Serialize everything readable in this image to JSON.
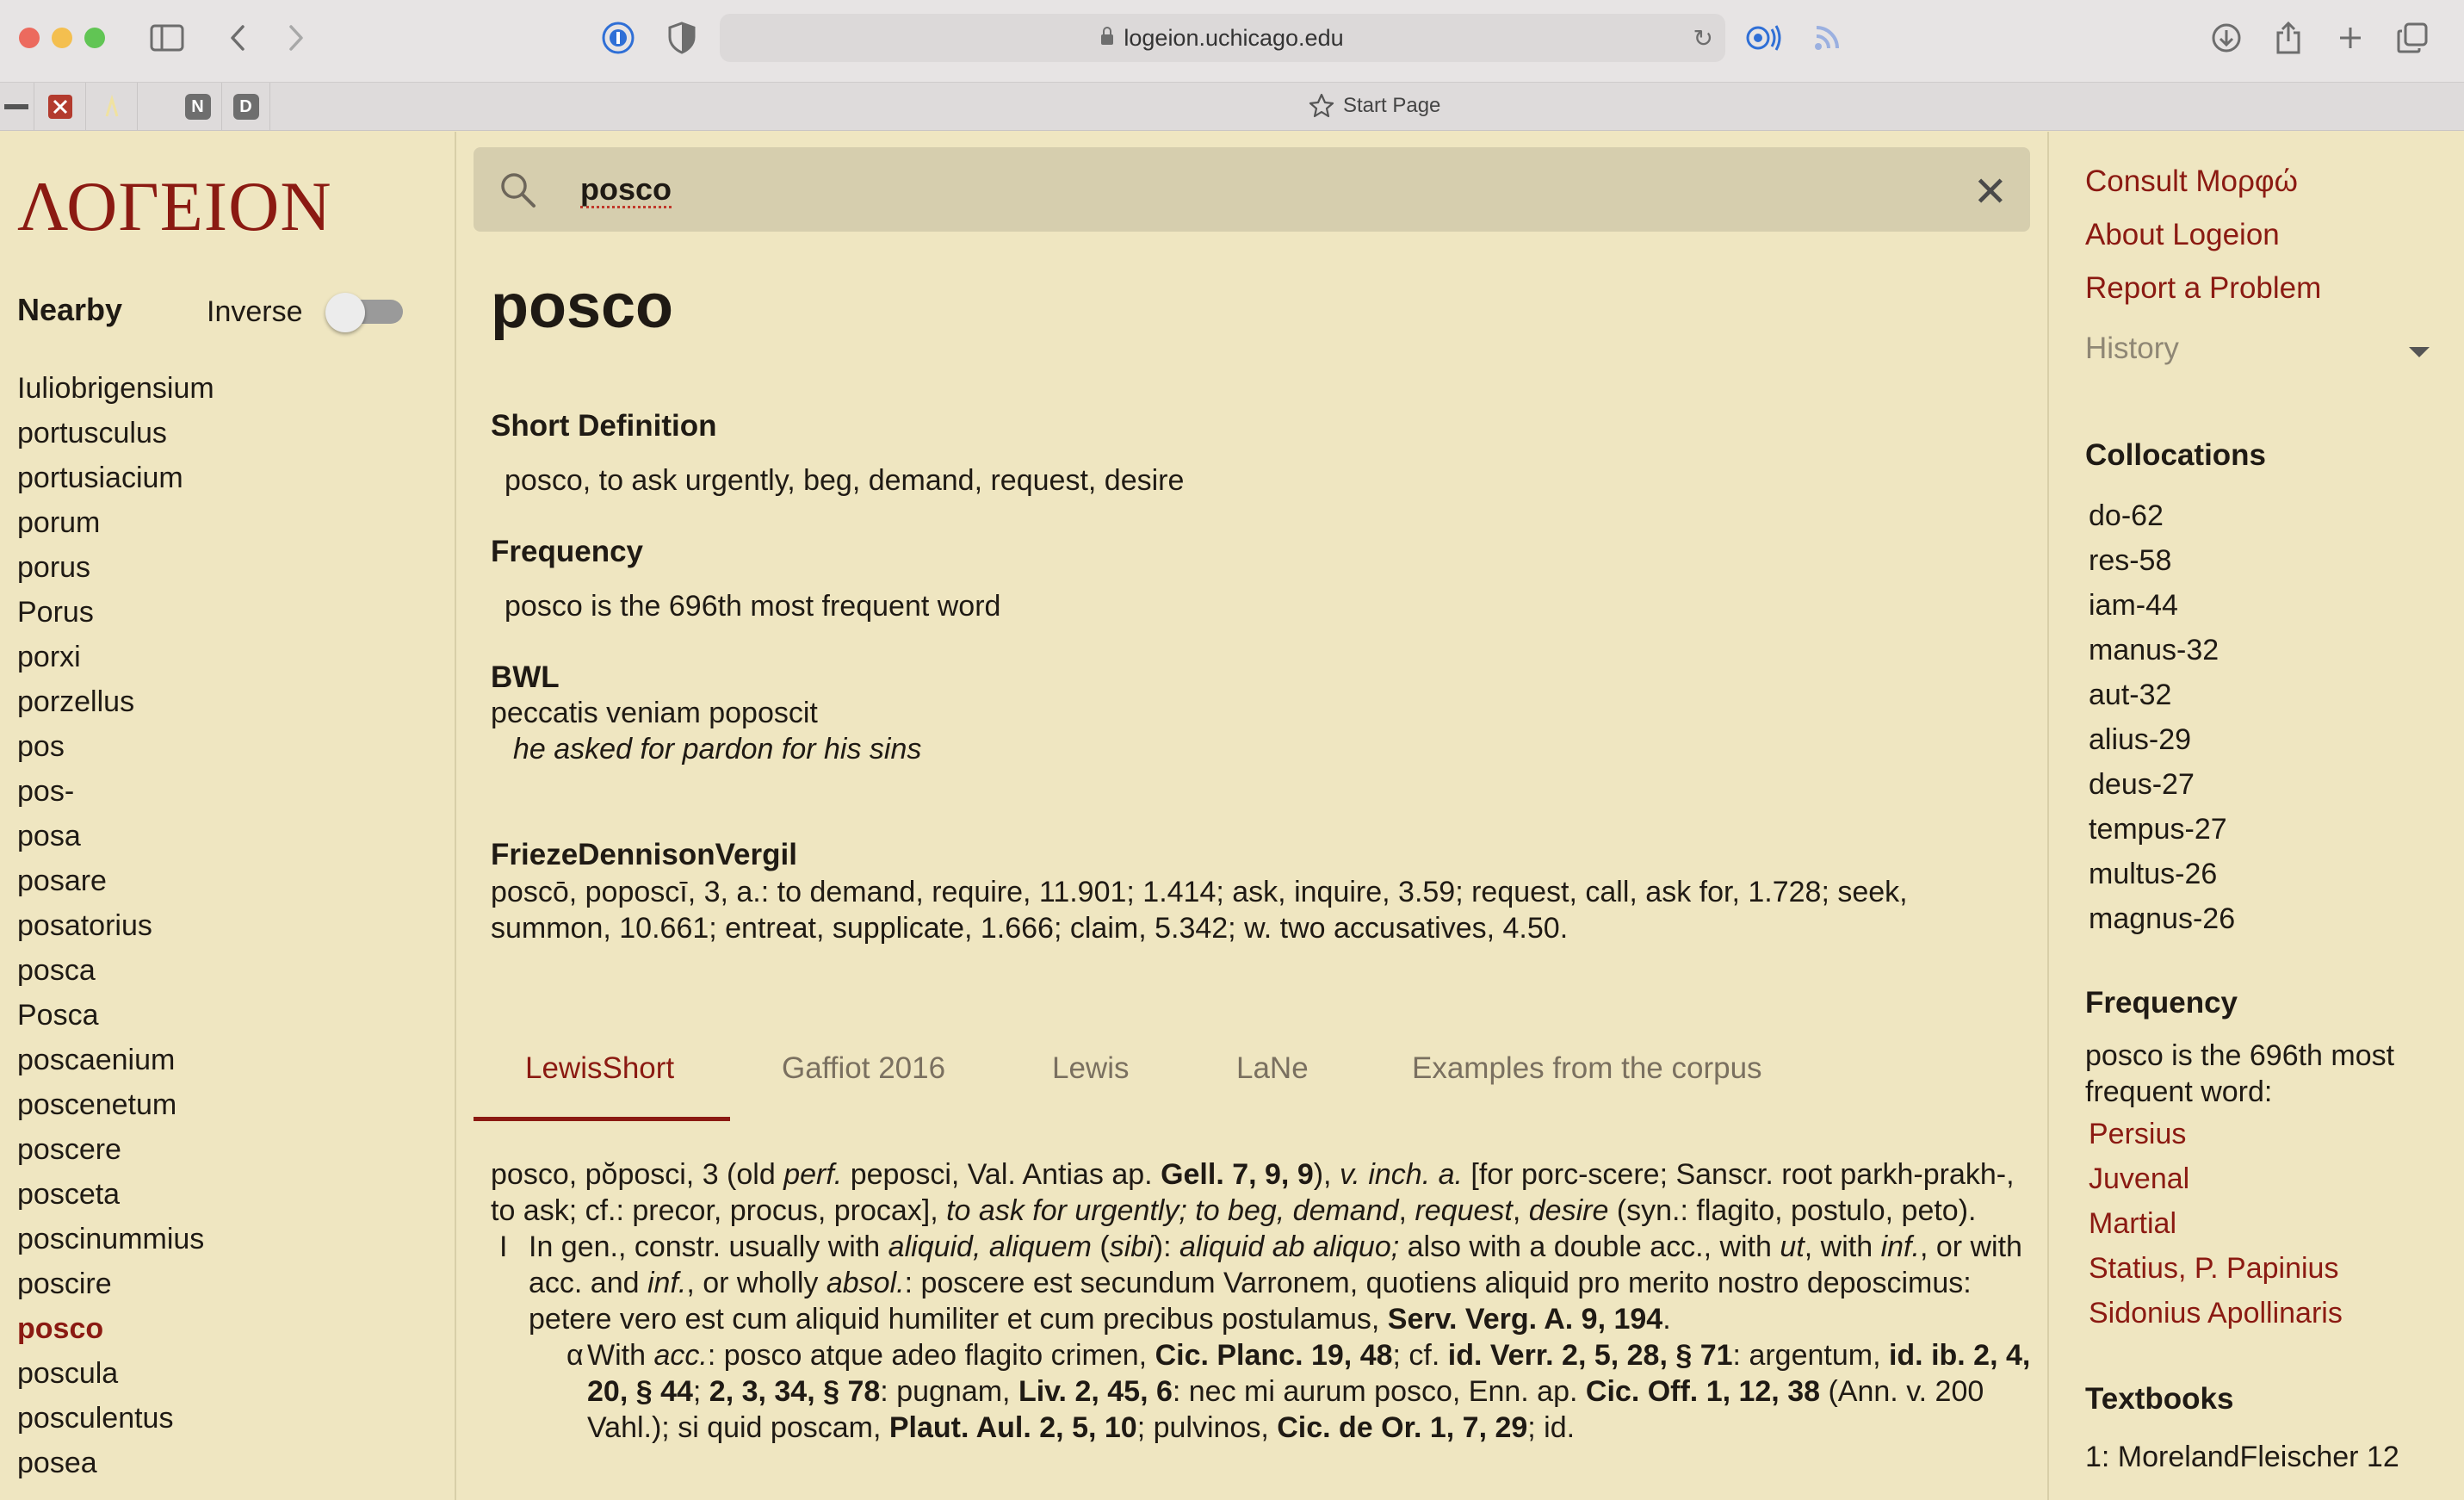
{
  "browser": {
    "url": "logeion.uchicago.edu",
    "start_page_label": "Start Page",
    "pinned_tabs": [
      "N",
      "D"
    ]
  },
  "sidebar": {
    "logo": "ΛΟΓΕΙΟΝ",
    "nearby_label": "Nearby",
    "inverse_label": "Inverse",
    "inverse_on": false,
    "words": [
      "Iuliobrigensium",
      "portusculus",
      "portusiacium",
      "porum",
      "porus",
      "Porus",
      "porxi",
      "porzellus",
      "pos",
      "pos-",
      "posa",
      "posare",
      "posatorius",
      "posca",
      "Posca",
      "poscaenium",
      "poscenetum",
      "poscere",
      "posceta",
      "poscinummius",
      "poscire",
      "posco",
      "poscula",
      "posculentus",
      "posea"
    ],
    "active_word": "posco"
  },
  "search": {
    "query": "posco"
  },
  "main": {
    "headword": "posco",
    "short_def_heading": "Short Definition",
    "short_def": "posco, to ask urgently, beg, demand, request, desire",
    "freq_heading": "Frequency",
    "freq_text": "posco is the 696th most frequent word",
    "bwl_heading": "BWL",
    "bwl_latin": "peccatis veniam poposcit",
    "bwl_translation": "he asked for pardon for his sins",
    "fd_heading": "FriezeDennisonVergil",
    "fd_text": "poscō, poposcī, 3, a.: to demand, require, 11.901; 1.414; ask, inquire, 3.59; request, call, ask for, 1.728; seek, summon, 10.661; entreat, supplicate, 1.666; claim, 5.342; w. two accusatives, 4.50.",
    "tabs": [
      "LewisShort",
      "Gaffiot 2016",
      "Lewis",
      "LaNe",
      "Examples from the corpus"
    ],
    "active_tab": "LewisShort",
    "entry": {
      "p1a": "posco, pŏposci, 3 (old ",
      "p1b": "perf.",
      "p1c": " peposci, Val. Antias ap. ",
      "p1d": "Gell. 7, 9, 9",
      "p1e": "), ",
      "p1f": "v. inch. a.",
      "p1g": " [for porc-scere; Sanscr. root parkh-prakh-, to ask; cf.: precor, procus, procax], ",
      "p1h": "to ask for urgently; to beg, demand",
      "p1i": ", ",
      "p1j": "request",
      "p1k": ", ",
      "p1l": "desire",
      "p1m": " (syn.: flagito, postulo, peto).",
      "s1_num": "I",
      "s1a": "In gen., constr. usually with ",
      "s1b": "aliquid, aliquem",
      "s1c": " (",
      "s1d": "sibi",
      "s1e": "): ",
      "s1f": "aliquid ab aliquo;",
      "s1g": " also with a double acc., with ",
      "s1h": "ut",
      "s1i": ", with ",
      "s1j": "inf.",
      "s1k": ", or with acc. and ",
      "s1l": "inf.",
      "s1m": ", or wholly ",
      "s1n": "absol.",
      "s1o": ": poscere est secundum Varronem, quotiens aliquid pro merito nostro deposcimus: petere vero est cum aliquid humiliter et cum precibus postulamus, ",
      "s1p": "Serv. Verg. A. 9, 194",
      "s1q": ".",
      "s2_num": "α",
      "s2a": "With ",
      "s2b": "acc.",
      "s2c": ": posco atque adeo flagito crimen, ",
      "s2d": "Cic. Planc. 19, 48",
      "s2e": "; cf. ",
      "s2f": "id. Verr. 2, 5, 28, § 71",
      "s2g": ": argentum, ",
      "s2h": "id. ib. 2, 4, 20, § 44",
      "s2i": "; ",
      "s2j": "2, 3, 34, § 78",
      "s2k": ": pugnam, ",
      "s2l": "Liv. 2, 45, 6",
      "s2m": ": nec mi aurum posco, Enn. ap. ",
      "s2n": "Cic. Off. 1, 12, 38",
      "s2o": " (Ann. v. 200 Vahl.); si quid poscam, ",
      "s2p": "Plaut. Aul. 2, 5, 10",
      "s2q": "; pulvinos, ",
      "s2r": "Cic. de Or. 1, 7, 29",
      "s2s": "; id."
    }
  },
  "right": {
    "links": [
      "Consult Μορφώ",
      "About Logeion",
      "Report a Problem"
    ],
    "history_label": "History",
    "collocations_heading": "Collocations",
    "collocations": [
      "do-62",
      "res-58",
      "iam-44",
      "manus-32",
      "aut-32",
      "alius-29",
      "deus-27",
      "tempus-27",
      "multus-26",
      "magnus-26"
    ],
    "frequency_heading": "Frequency",
    "frequency_text": "posco is the 696th most frequent word:",
    "authors": [
      "Persius",
      "Juvenal",
      "Martial",
      "Statius, P. Papinius",
      "Sidonius Apollinaris"
    ],
    "textbooks_heading": "Textbooks",
    "textbook_entry": "1: MorelandFleischer 12"
  }
}
